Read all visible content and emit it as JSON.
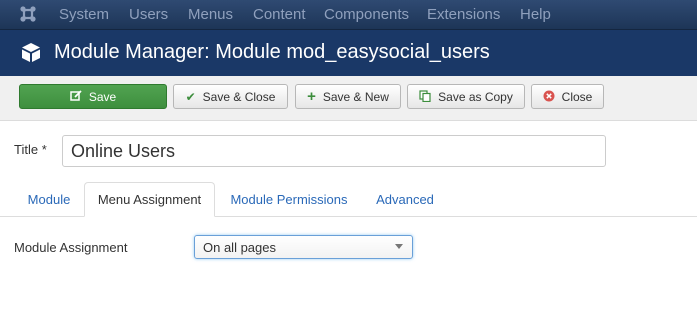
{
  "nav": {
    "items": [
      "System",
      "Users",
      "Menus",
      "Content",
      "Components",
      "Extensions",
      "Help"
    ]
  },
  "header": {
    "title": "Module Manager: Module mod_easysocial_users"
  },
  "toolbar": {
    "save": "Save",
    "save_close": "Save & Close",
    "save_new": "Save & New",
    "save_copy": "Save as Copy",
    "close": "Close"
  },
  "form": {
    "title_label": "Title *",
    "title_value": "Online Users"
  },
  "tabs": [
    "Module",
    "Menu Assignment",
    "Module Permissions",
    "Advanced"
  ],
  "active_tab": "Menu Assignment",
  "assignment": {
    "label": "Module Assignment",
    "selected": "On all pages"
  },
  "colors": {
    "navbar": "#1d3557",
    "header": "#1a3867",
    "save_button": "#46a046",
    "close_icon": "#d9534f",
    "link": "#2a69b8"
  }
}
